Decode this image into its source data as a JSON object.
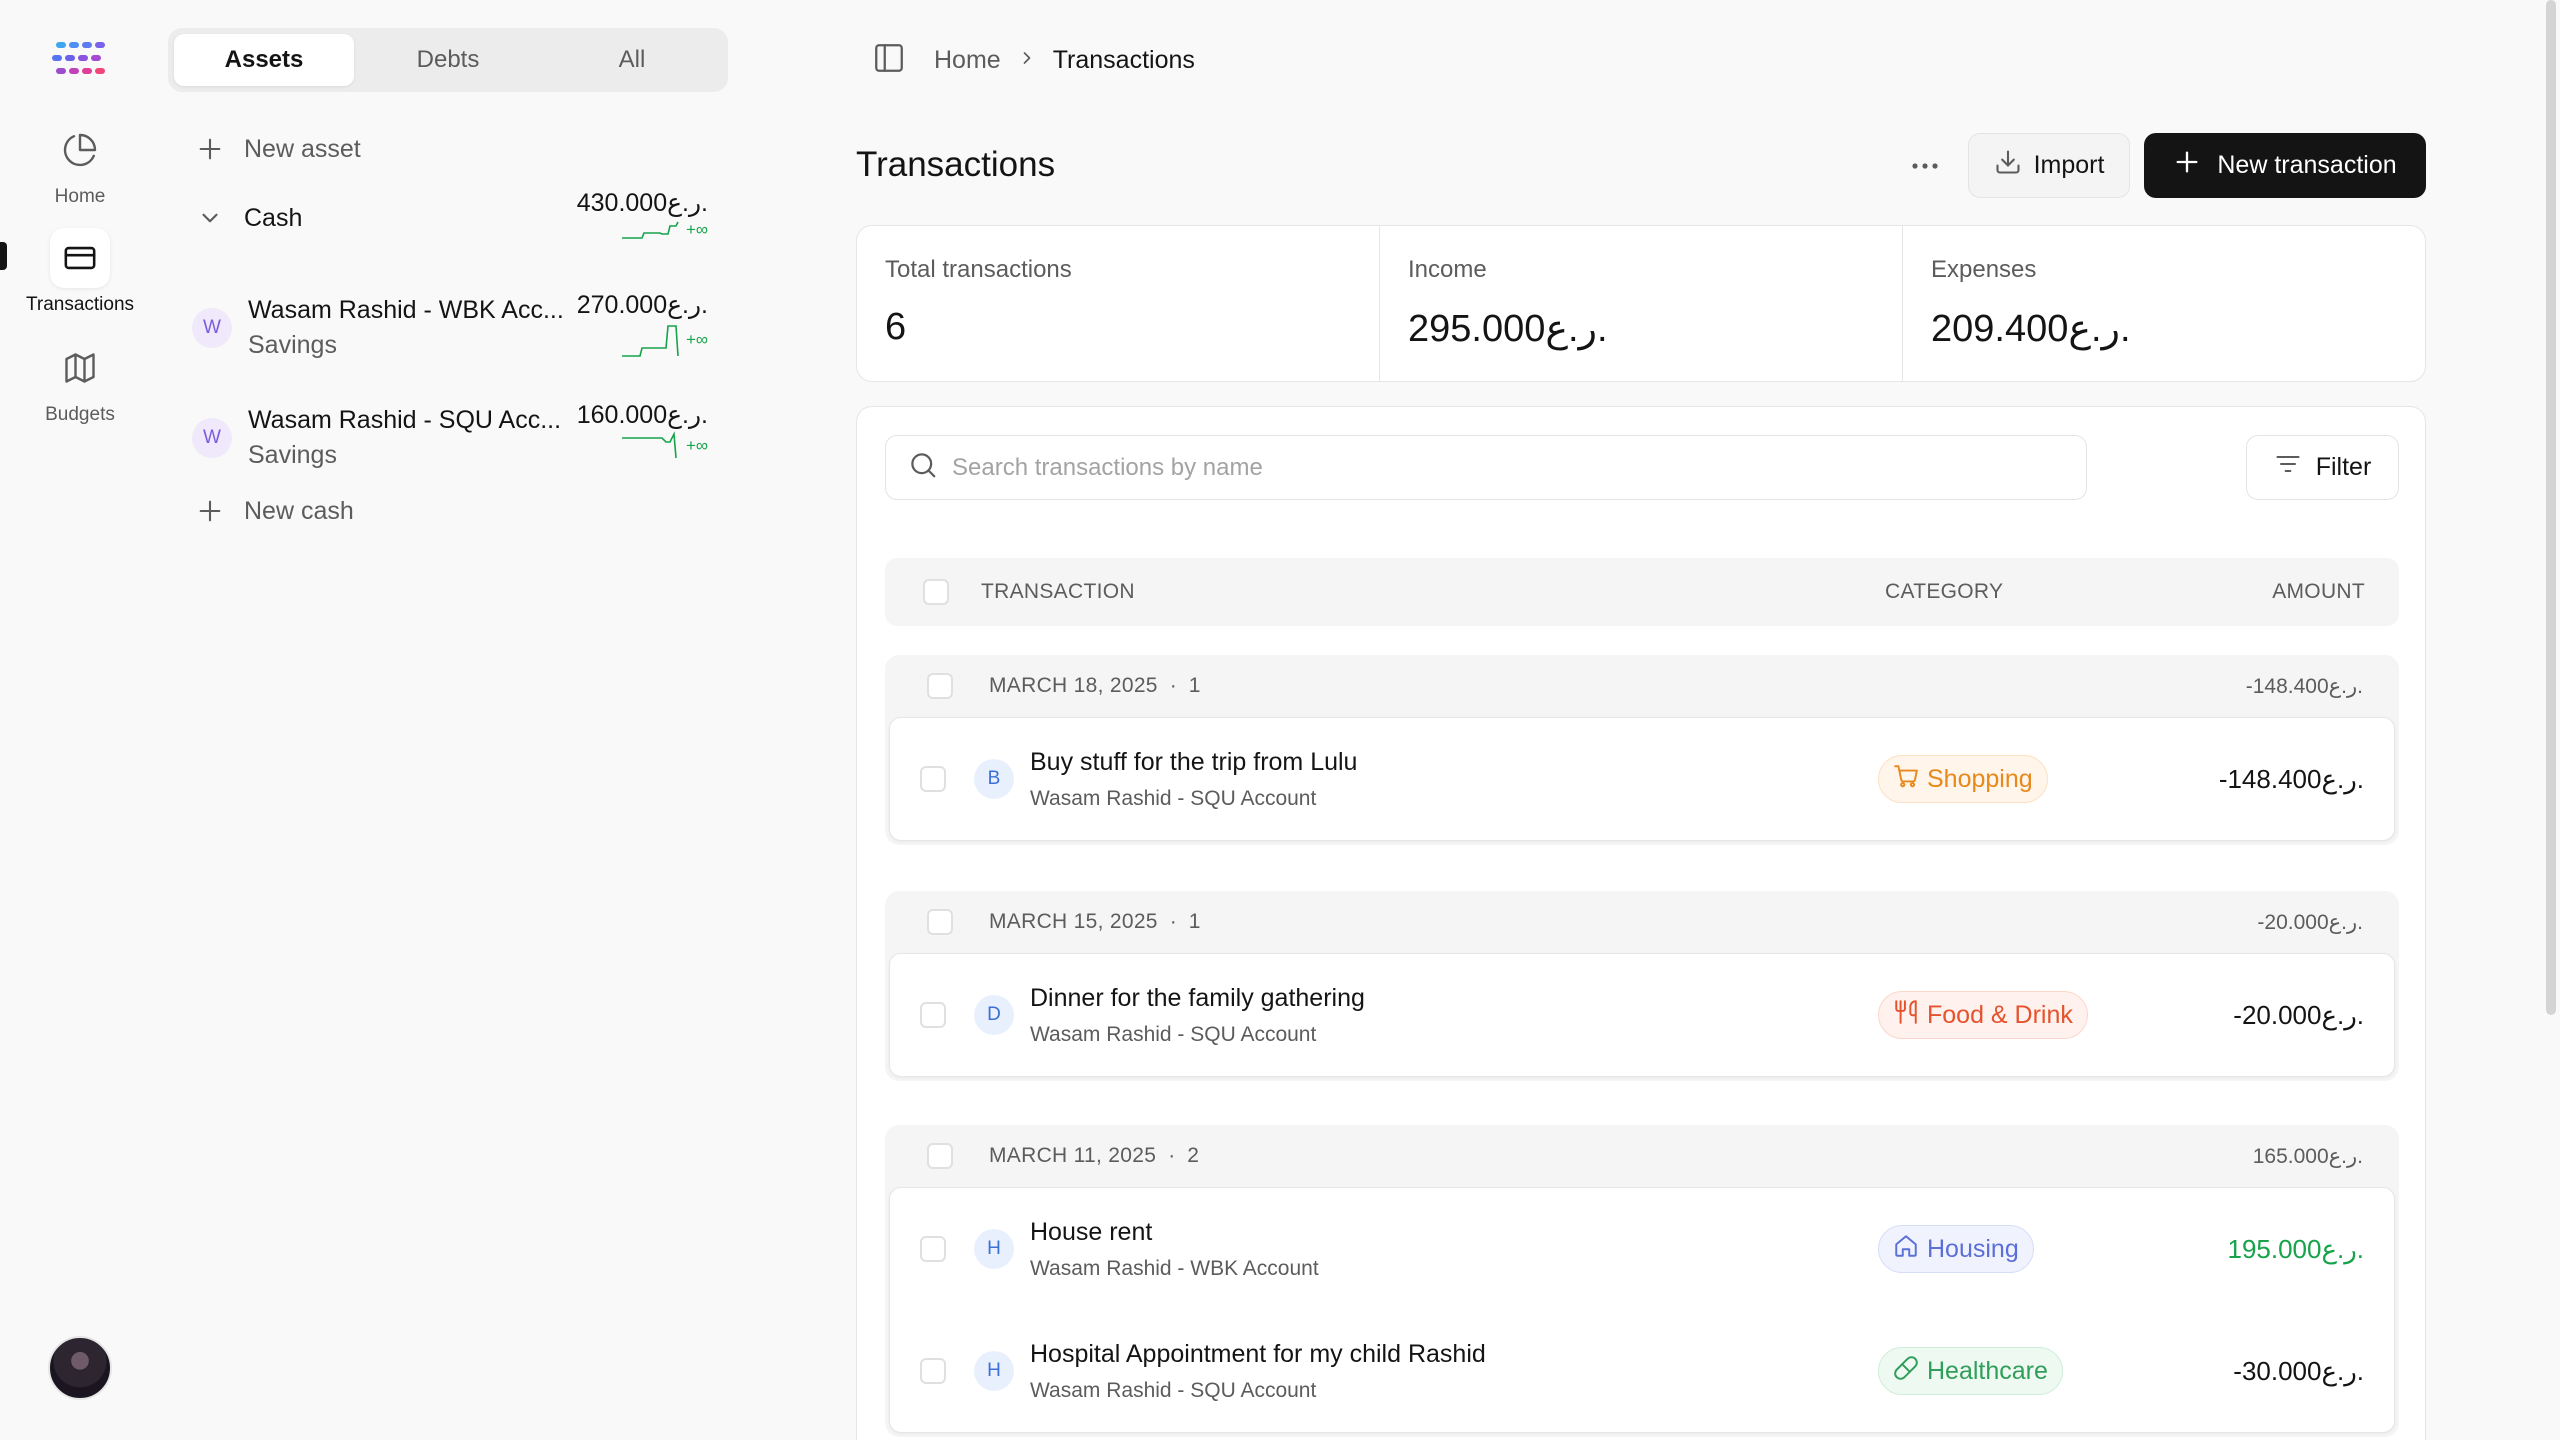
{
  "nav": {
    "items": [
      {
        "label": "Home",
        "icon": "pie-chart-icon"
      },
      {
        "label": "Transactions",
        "icon": "credit-card-icon",
        "active": true
      },
      {
        "label": "Budgets",
        "icon": "map-icon"
      }
    ]
  },
  "accounts": {
    "tabs": [
      "Assets",
      "Debts",
      "All"
    ],
    "active_tab": "Assets",
    "new_asset_label": "New asset",
    "group": {
      "name": "Cash",
      "amount": "430.000ر.ع.",
      "change": "+∞"
    },
    "items": [
      {
        "initial": "W",
        "name": "Wasam Rashid - WBK Acc...",
        "type": "Savings",
        "amount": "270.000ر.ع.",
        "change": "+∞"
      },
      {
        "initial": "W",
        "name": "Wasam Rashid - SQU Acc...",
        "type": "Savings",
        "amount": "160.000ر.ع.",
        "change": "+∞"
      }
    ],
    "new_cash_label": "New cash"
  },
  "header": {
    "breadcrumb_home": "Home",
    "breadcrumb_current": "Transactions",
    "page_title": "Transactions",
    "import_label": "Import",
    "new_transaction_label": "New transaction"
  },
  "stats": {
    "total_label": "Total transactions",
    "total_value": "6",
    "income_label": "Income",
    "income_value": "295.000ر.ع.",
    "expenses_label": "Expenses",
    "expenses_value": "209.400ر.ع."
  },
  "table": {
    "search_placeholder": "Search transactions by name",
    "filter_label": "Filter",
    "columns": {
      "transaction": "TRANSACTION",
      "category": "CATEGORY",
      "amount": "AMOUNT"
    },
    "groups": [
      {
        "date": "MARCH 18, 2025",
        "count": "1",
        "total": "-148.400ر.ع.",
        "rows": [
          {
            "initial": "B",
            "name": "Buy stuff for the trip from Lulu",
            "account": "Wasam Rashid - SQU Account",
            "category": "Shopping",
            "category_icon": "shopping-cart-icon",
            "amount": "-148.400ر.ع."
          }
        ]
      },
      {
        "date": "MARCH 15, 2025",
        "count": "1",
        "total": "-20.000ر.ع.",
        "rows": [
          {
            "initial": "D",
            "name": "Dinner for the family gathering",
            "account": "Wasam Rashid - SQU Account",
            "category": "Food & Drink",
            "category_icon": "utensils-icon",
            "amount": "-20.000ر.ع."
          }
        ]
      },
      {
        "date": "MARCH 11, 2025",
        "count": "2",
        "total": "165.000ر.ع.",
        "rows": [
          {
            "initial": "H",
            "name": "House rent",
            "account": "Wasam Rashid - WBK Account",
            "category": "Housing",
            "category_icon": "house-icon",
            "amount": "195.000ر.ع."
          },
          {
            "initial": "H",
            "name": "Hospital Appointment for my child Rashid",
            "account": "Wasam Rashid - SQU Account",
            "category": "Healthcare",
            "category_icon": "pill-icon",
            "amount": "-30.000ر.ع."
          }
        ]
      }
    ]
  },
  "colors": {
    "primary_button": "#141414",
    "positive_amount": "#16a34a",
    "shopping": "#e8891c",
    "food": "#e5532d",
    "housing": "#5b6fd6",
    "healthcare": "#2f9e5a"
  }
}
